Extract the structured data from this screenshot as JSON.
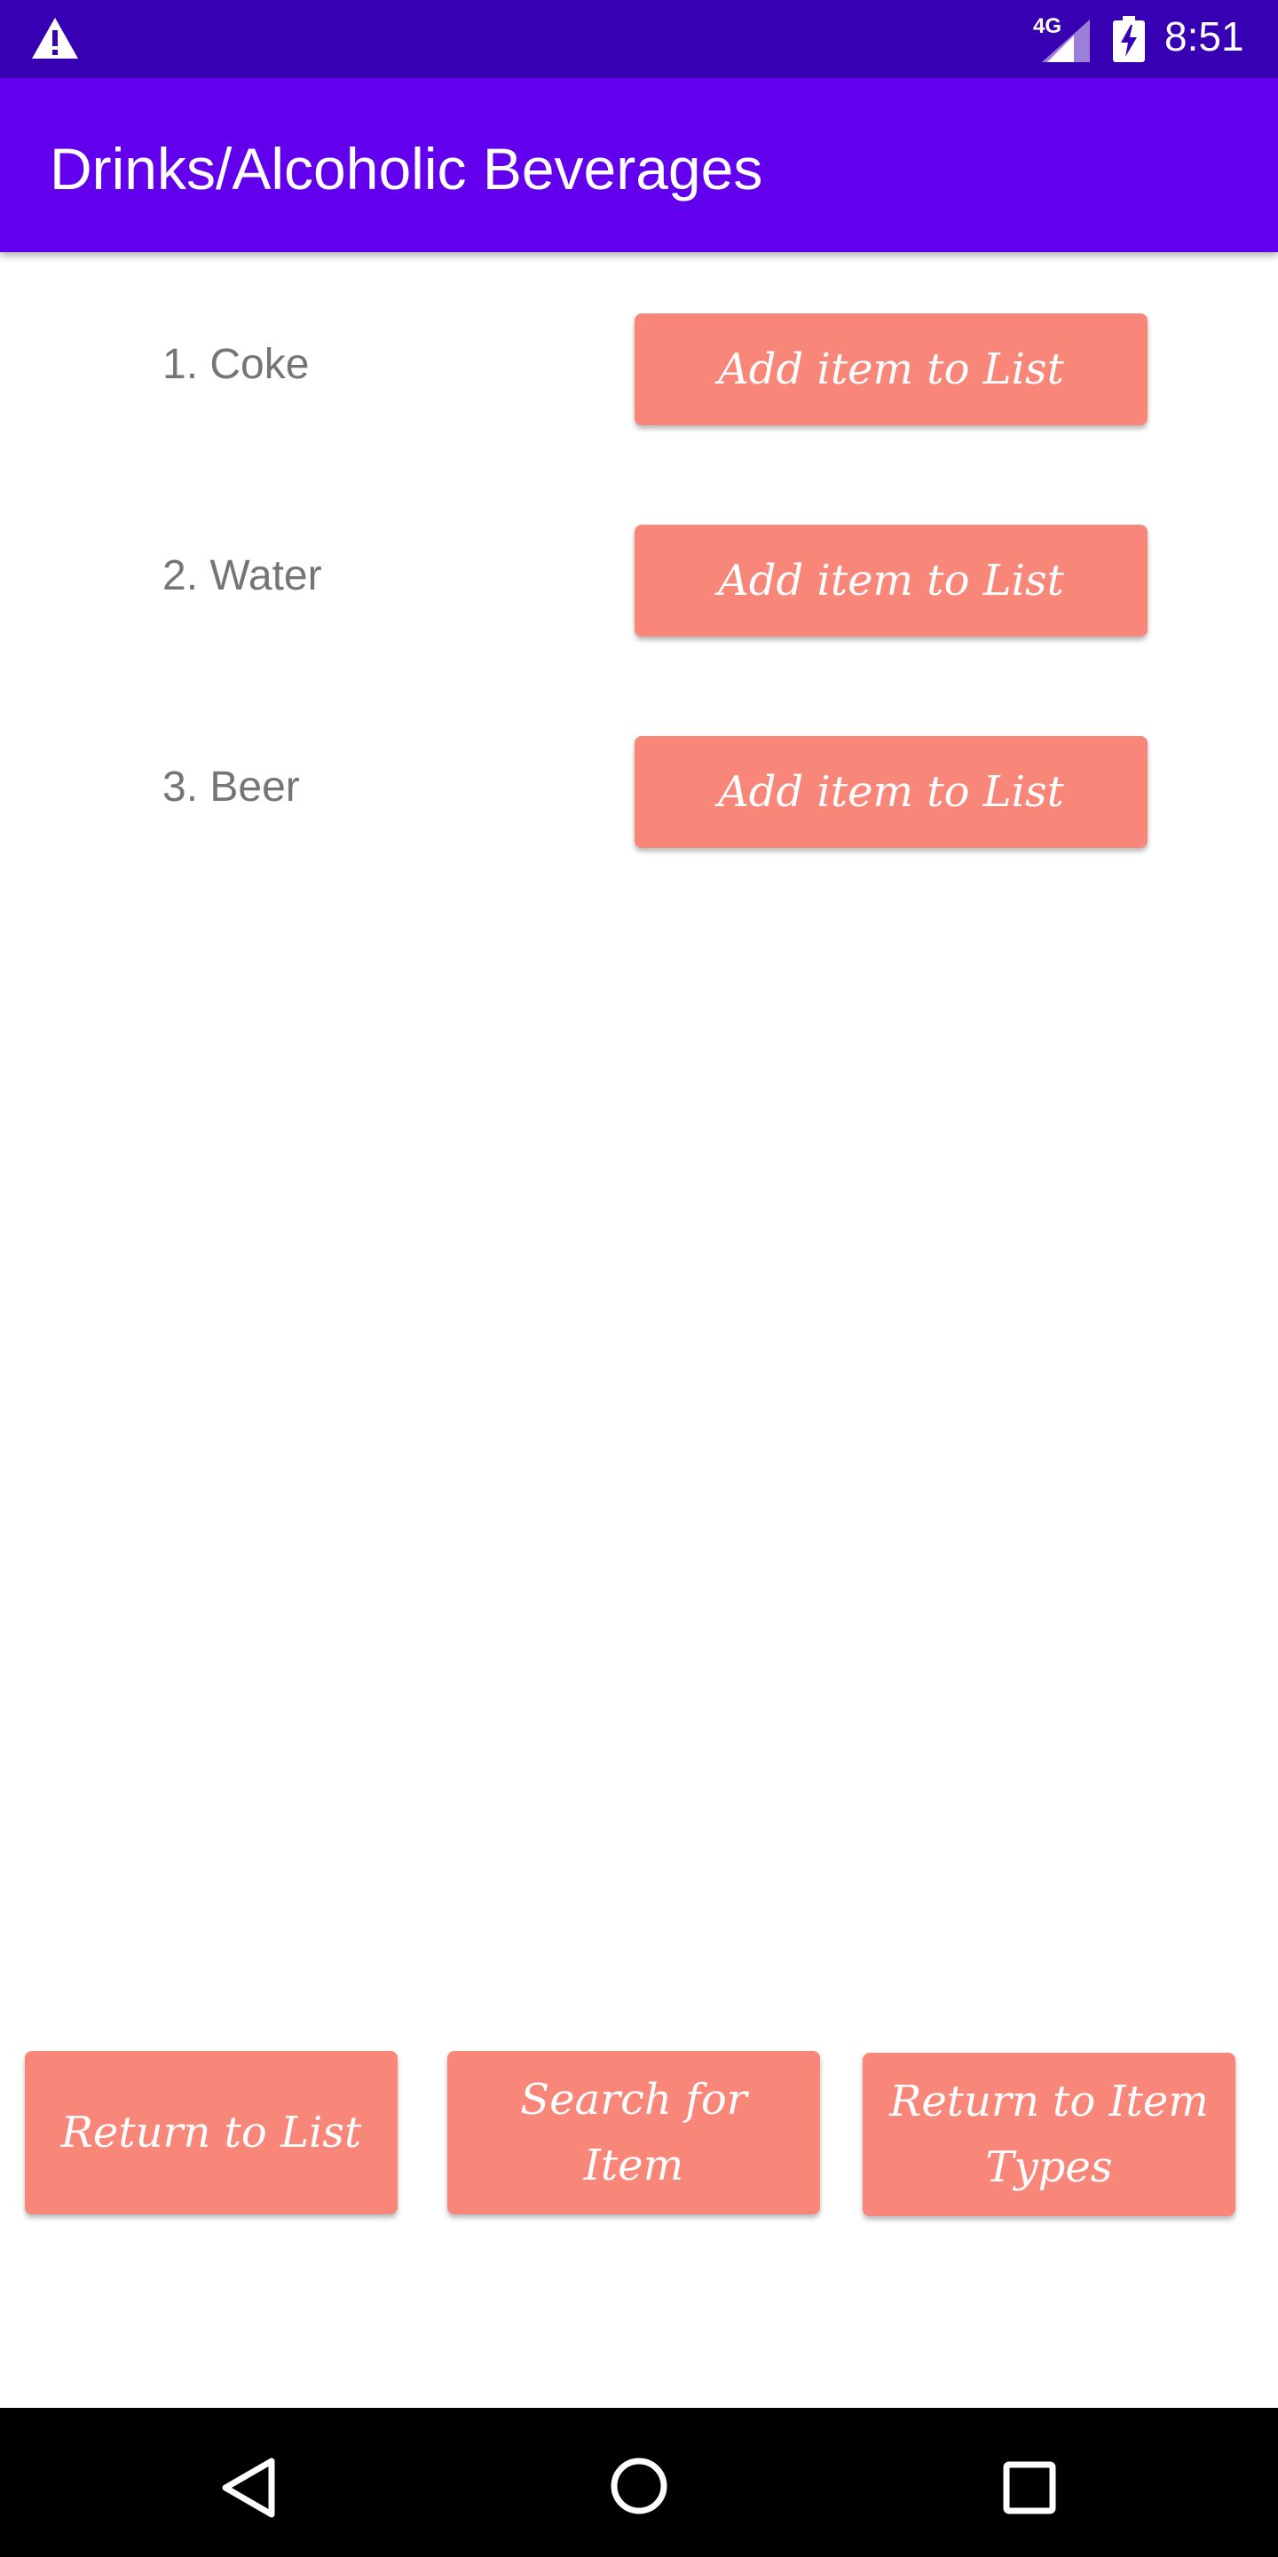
{
  "status_bar": {
    "network_label": "4G",
    "time": "8:51",
    "icons": [
      "warning-icon",
      "signal-icon",
      "battery-charging-icon"
    ]
  },
  "app_bar": {
    "title": "Drinks/Alcoholic Beverages"
  },
  "items": [
    {
      "label": "1. Coke",
      "button_label": "Add item to List"
    },
    {
      "label": "2. Water",
      "button_label": "Add item to List"
    },
    {
      "label": "3. Beer",
      "button_label": "Add item to List"
    }
  ],
  "bottom_buttons": {
    "return_to_list": "Return to List",
    "search_for_item": "Search for Item",
    "return_to_item_types": "Return to Item Types"
  },
  "nav_bar": {
    "icons": [
      "back-icon",
      "home-icon",
      "recents-icon"
    ]
  },
  "colors": {
    "status_bar": "#3700b3",
    "app_bar": "#6200ee",
    "button": "#f8877a",
    "item_text": "#757575",
    "nav_bar": "#000000"
  }
}
